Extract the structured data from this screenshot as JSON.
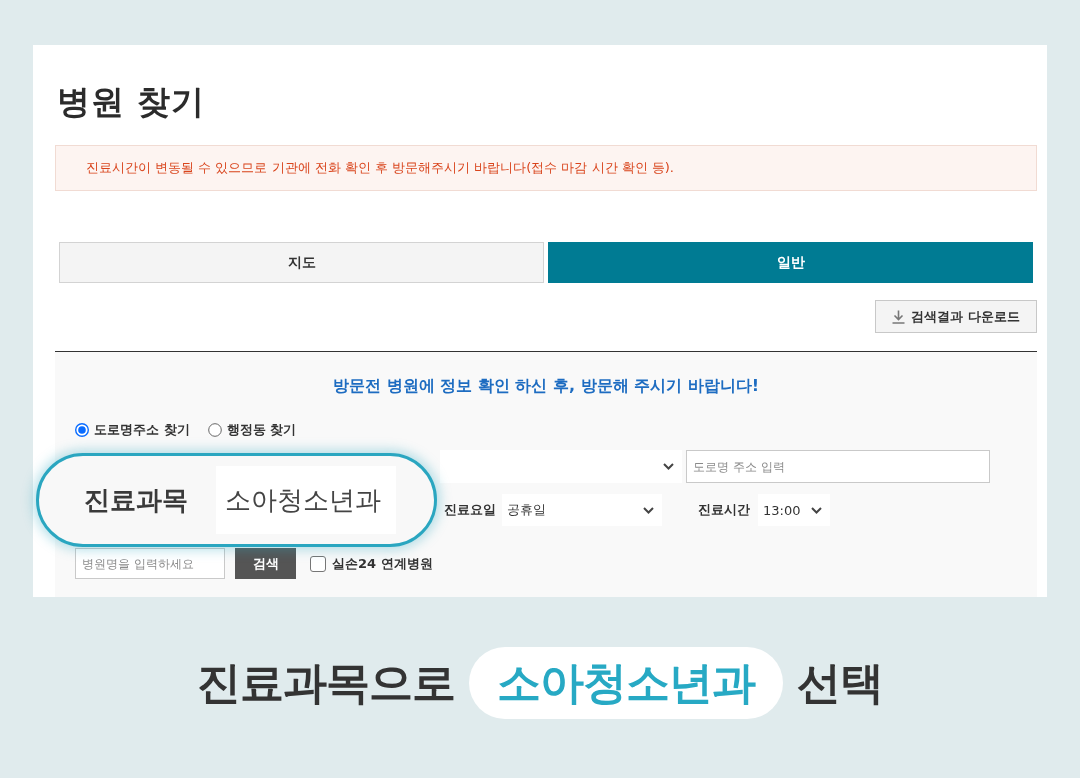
{
  "page": {
    "title": "병원 찾기",
    "notice": "진료시간이 변동될 수 있으므로 기관에 전화 확인 후 방문해주시기 바랍니다(접수 마감 시간 확인 등)."
  },
  "tabs": [
    {
      "label": "지도",
      "selected": false
    },
    {
      "label": "일반",
      "selected": true
    }
  ],
  "download_button": {
    "label": "검색결과 다운로드"
  },
  "search": {
    "heading": "방문전 병원에 정보 확인 하신 후, 방문해 주시기 바랍니다!",
    "address_modes": [
      {
        "label": "도로명주소 찾기",
        "selected": true
      },
      {
        "label": "행정동 찾기",
        "selected": false
      }
    ],
    "road_address_input": {
      "placeholder": "도로명 주소 입력"
    },
    "day": {
      "label": "진료요일",
      "value": "공휴일"
    },
    "time": {
      "label": "진료시간",
      "value": "13:00"
    },
    "name_input": {
      "placeholder": "병원명을 입력하세요"
    },
    "search_button": {
      "label": "검색"
    },
    "linked_only": {
      "label": "실손24 연계병원",
      "checked": false
    }
  },
  "magnifier": {
    "label": "진료과목",
    "value": "소아청소년과"
  },
  "caption": {
    "before": "진료과목으로",
    "highlight": "소아청소년과",
    "after": "선택"
  }
}
